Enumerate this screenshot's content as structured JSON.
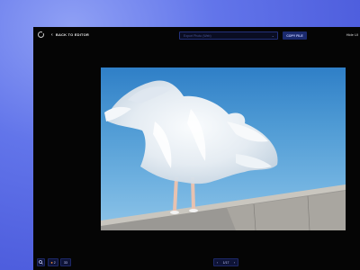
{
  "header": {
    "back_label": "BACK TO EDITOR",
    "select_placeholder": "Export Photo (Web)",
    "copy_label": "COPY FILE",
    "hide_ui_label": "Hide UI"
  },
  "footer": {
    "likes_count": "2",
    "zoom_value": "33",
    "page_label": "1/17"
  },
  "icons": {
    "logo": "logo-icon",
    "back": "chevron-left-icon",
    "dropdown": "chevron-down-icon",
    "search": "search-icon",
    "like": "hand-icon",
    "prev": "chevron-left-icon",
    "next": "chevron-right-icon"
  },
  "colors": {
    "background": "#5b6ee6",
    "window": "#050505",
    "accent": "#1b2a6e",
    "sky": "#4e9ad4"
  }
}
